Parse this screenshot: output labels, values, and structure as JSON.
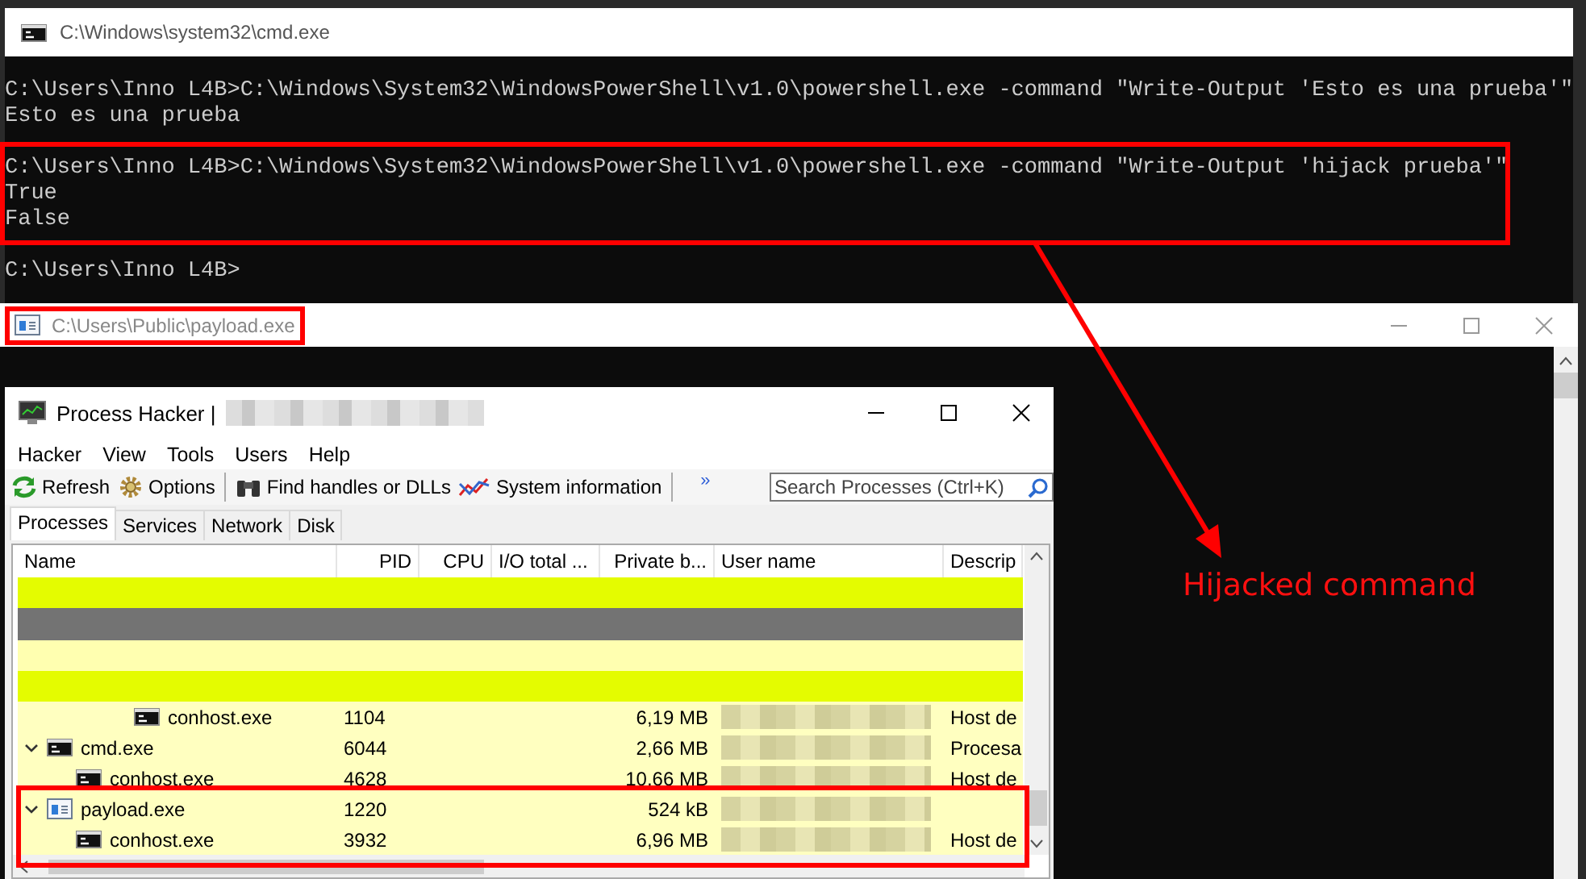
{
  "cmd_window": {
    "title": "C:\\Windows\\system32\\cmd.exe",
    "blocks": [
      [
        "C:\\Users\\Inno L4B>C:\\Windows\\System32\\WindowsPowerShell\\v1.0\\powershell.exe -command \"Write-Output 'Esto es una prueba'\"",
        "Esto es una prueba"
      ],
      [
        "C:\\Users\\Inno L4B>C:\\Windows\\System32\\WindowsPowerShell\\v1.0\\powershell.exe -command \"Write-Output 'hijack prueba'\"",
        "True",
        "False"
      ],
      [
        "C:\\Users\\Inno L4B>"
      ]
    ]
  },
  "payload_window": {
    "title": "C:\\Users\\Public\\payload.exe"
  },
  "process_hacker": {
    "title": "Process Hacker |",
    "menu": [
      "Hacker",
      "View",
      "Tools",
      "Users",
      "Help"
    ],
    "toolbar": [
      {
        "kind": "refresh",
        "label": "Refresh"
      },
      {
        "kind": "options",
        "label": "Options"
      },
      {
        "kind": "separator"
      },
      {
        "kind": "find",
        "label": "Find handles or DLLs"
      },
      {
        "kind": "sysinfo",
        "label": "System information"
      },
      {
        "kind": "separator"
      }
    ],
    "overflow": "»",
    "search": {
      "placeholder": "Search Processes (Ctrl+K)"
    },
    "tabs": [
      {
        "label": "Processes",
        "selected": true
      },
      {
        "label": "Services",
        "selected": false
      },
      {
        "label": "Network",
        "selected": false
      },
      {
        "label": "Disk",
        "selected": false
      }
    ],
    "columns": [
      "Name",
      "PID",
      "CPU",
      "I/O total ...",
      "Private b...",
      "User name",
      "Descrip"
    ],
    "rows": [
      {
        "kind": "redacted",
        "color": "#e4fc00",
        "children": [
          {
            "kind": "redacted",
            "color": "#737373",
            "children": [
              {
                "kind": "redacted",
                "color": "#ffffb0"
              },
              {
                "kind": "redacted",
                "color": "#e4fc00",
                "children": [
                  {
                    "kind": "console_process",
                    "name": "conhost.exe",
                    "pid": "1104",
                    "private_bytes": "6,19 MB",
                    "description": "Host de"
                  }
                ]
              }
            ]
          }
        ]
      },
      {
        "kind": "console_process",
        "name": "cmd.exe",
        "pid": "6044",
        "private_bytes": "2,66 MB",
        "description": "Procesa",
        "expanded": true,
        "children": [
          {
            "kind": "console_process",
            "name": "conhost.exe",
            "pid": "4628",
            "private_bytes": "10,66 MB",
            "description": "Host de"
          }
        ]
      },
      {
        "kind": "window_process",
        "name": "payload.exe",
        "pid": "1220",
        "private_bytes": "524 kB",
        "expanded": true,
        "children": [
          {
            "kind": "console_process",
            "name": "conhost.exe",
            "pid": "3932",
            "private_bytes": "6,96 MB",
            "description": "Host de"
          }
        ]
      }
    ]
  },
  "annotation": {
    "label": "Hijacked command"
  }
}
